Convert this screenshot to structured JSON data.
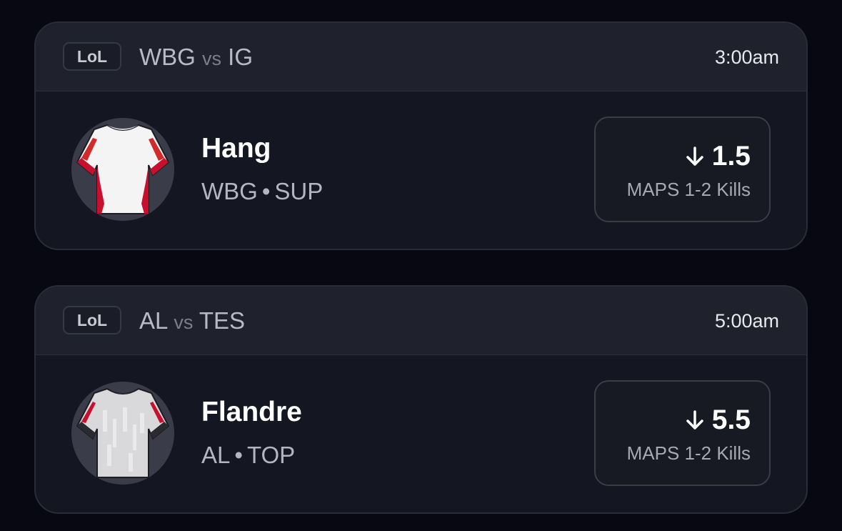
{
  "cards": [
    {
      "league": "LoL",
      "team_a": "WBG",
      "vs": "vs",
      "team_b": "IG",
      "time": "3:00am",
      "player": {
        "name": "Hang",
        "team": "WBG",
        "separator": "•",
        "position": "SUP"
      },
      "jersey_icon": "jersey-red-white-icon",
      "prop": {
        "direction_icon": "arrow-down-icon",
        "line": "1.5",
        "stat": "MAPS 1-2 Kills"
      }
    },
    {
      "league": "LoL",
      "team_a": "AL",
      "vs": "vs",
      "team_b": "TES",
      "time": "5:00am",
      "player": {
        "name": "Flandre",
        "team": "AL",
        "separator": "•",
        "position": "TOP"
      },
      "jersey_icon": "jersey-grey-pattern-icon",
      "prop": {
        "direction_icon": "arrow-down-icon",
        "line": "5.5",
        "stat": "MAPS 1-2 Kills"
      }
    }
  ],
  "colors": {
    "background": "#070811",
    "card": "#141621",
    "card_header": "#1f212d",
    "jersey_accent_1": "#c8102e",
    "jersey_accent_2": "#d22a2a"
  }
}
